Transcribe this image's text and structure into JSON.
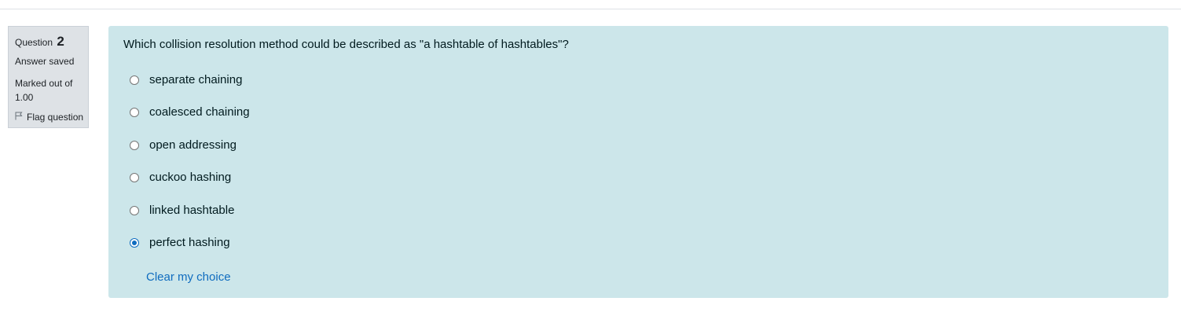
{
  "question_info": {
    "label": "Question",
    "number": "2",
    "state": "Answer saved",
    "grade": "Marked out of 1.00",
    "flag_label": "Flag question"
  },
  "question": {
    "text": "Which collision resolution method could be described as \"a hashtable of hashtables\"?",
    "options": [
      {
        "label": "separate chaining",
        "selected": false
      },
      {
        "label": "coalesced chaining",
        "selected": false
      },
      {
        "label": "open addressing",
        "selected": false
      },
      {
        "label": "cuckoo hashing",
        "selected": false
      },
      {
        "label": "linked hashtable",
        "selected": false
      },
      {
        "label": "perfect hashing",
        "selected": true
      }
    ],
    "clear_label": "Clear my choice"
  },
  "colors": {
    "content_bg": "#cce6ea",
    "info_bg": "#dee2e6",
    "accent": "#0f6cbf"
  },
  "icons": {
    "flag": "flag-icon"
  }
}
